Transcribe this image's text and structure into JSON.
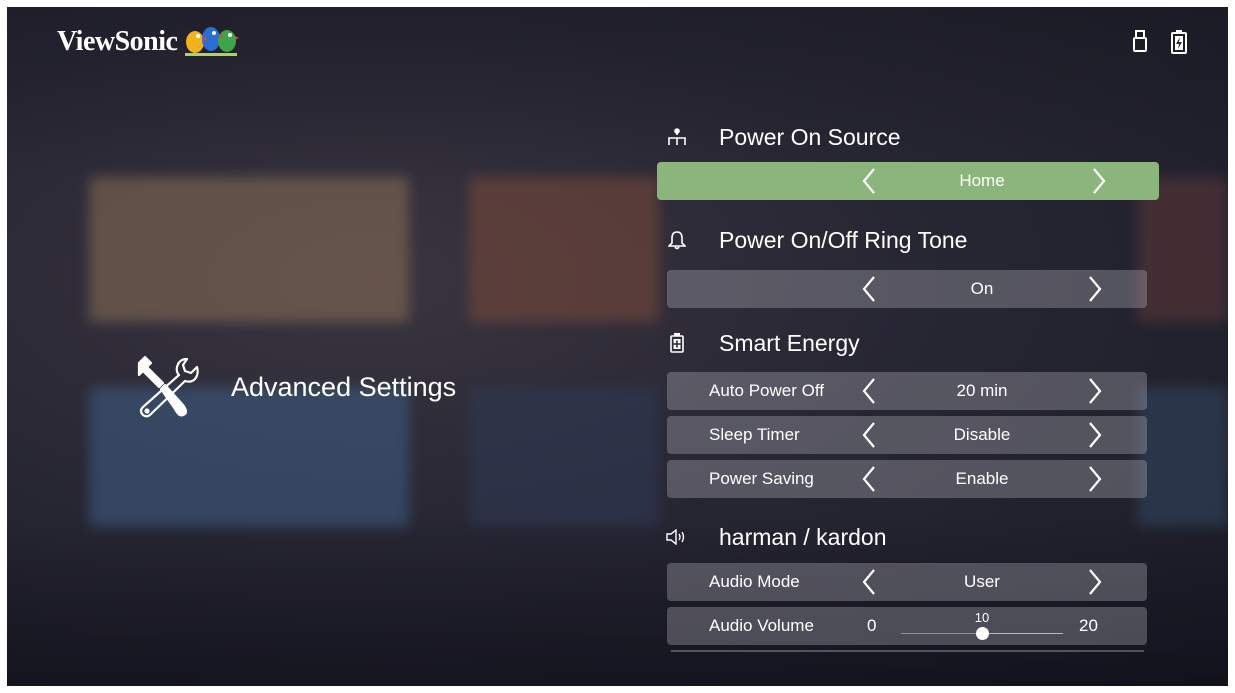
{
  "brand": {
    "name": "ViewSonic"
  },
  "status_icons": [
    "usb-drive-icon",
    "battery-charging-icon"
  ],
  "left": {
    "title": "Advanced Settings",
    "icon": "tools-icon"
  },
  "sections": {
    "power_on_source": {
      "title": "Power On Source",
      "icon": "network-source-icon",
      "value": "Home"
    },
    "ring_tone": {
      "title": "Power On/Off Ring Tone",
      "icon": "bell-icon",
      "value": "On"
    },
    "smart_energy": {
      "title": "Smart Energy",
      "icon": "battery-icon",
      "rows": [
        {
          "label": "Auto Power Off",
          "value": "20 min"
        },
        {
          "label": "Sleep Timer",
          "value": "Disable"
        },
        {
          "label": "Power Saving",
          "value": "Enable"
        }
      ]
    },
    "harman": {
      "title": "harman / kardon",
      "icon": "speaker-icon",
      "audio_mode": {
        "label": "Audio Mode",
        "value": "User"
      },
      "audio_volume": {
        "label": "Audio Volume",
        "min": "0",
        "max": "20",
        "value": "10",
        "level": 0.5
      }
    }
  },
  "colors": {
    "selected_row": "#8bb57c",
    "row_bg": "rgba(190,190,200,0.32)",
    "slider_fill": "#5aa0e0"
  }
}
